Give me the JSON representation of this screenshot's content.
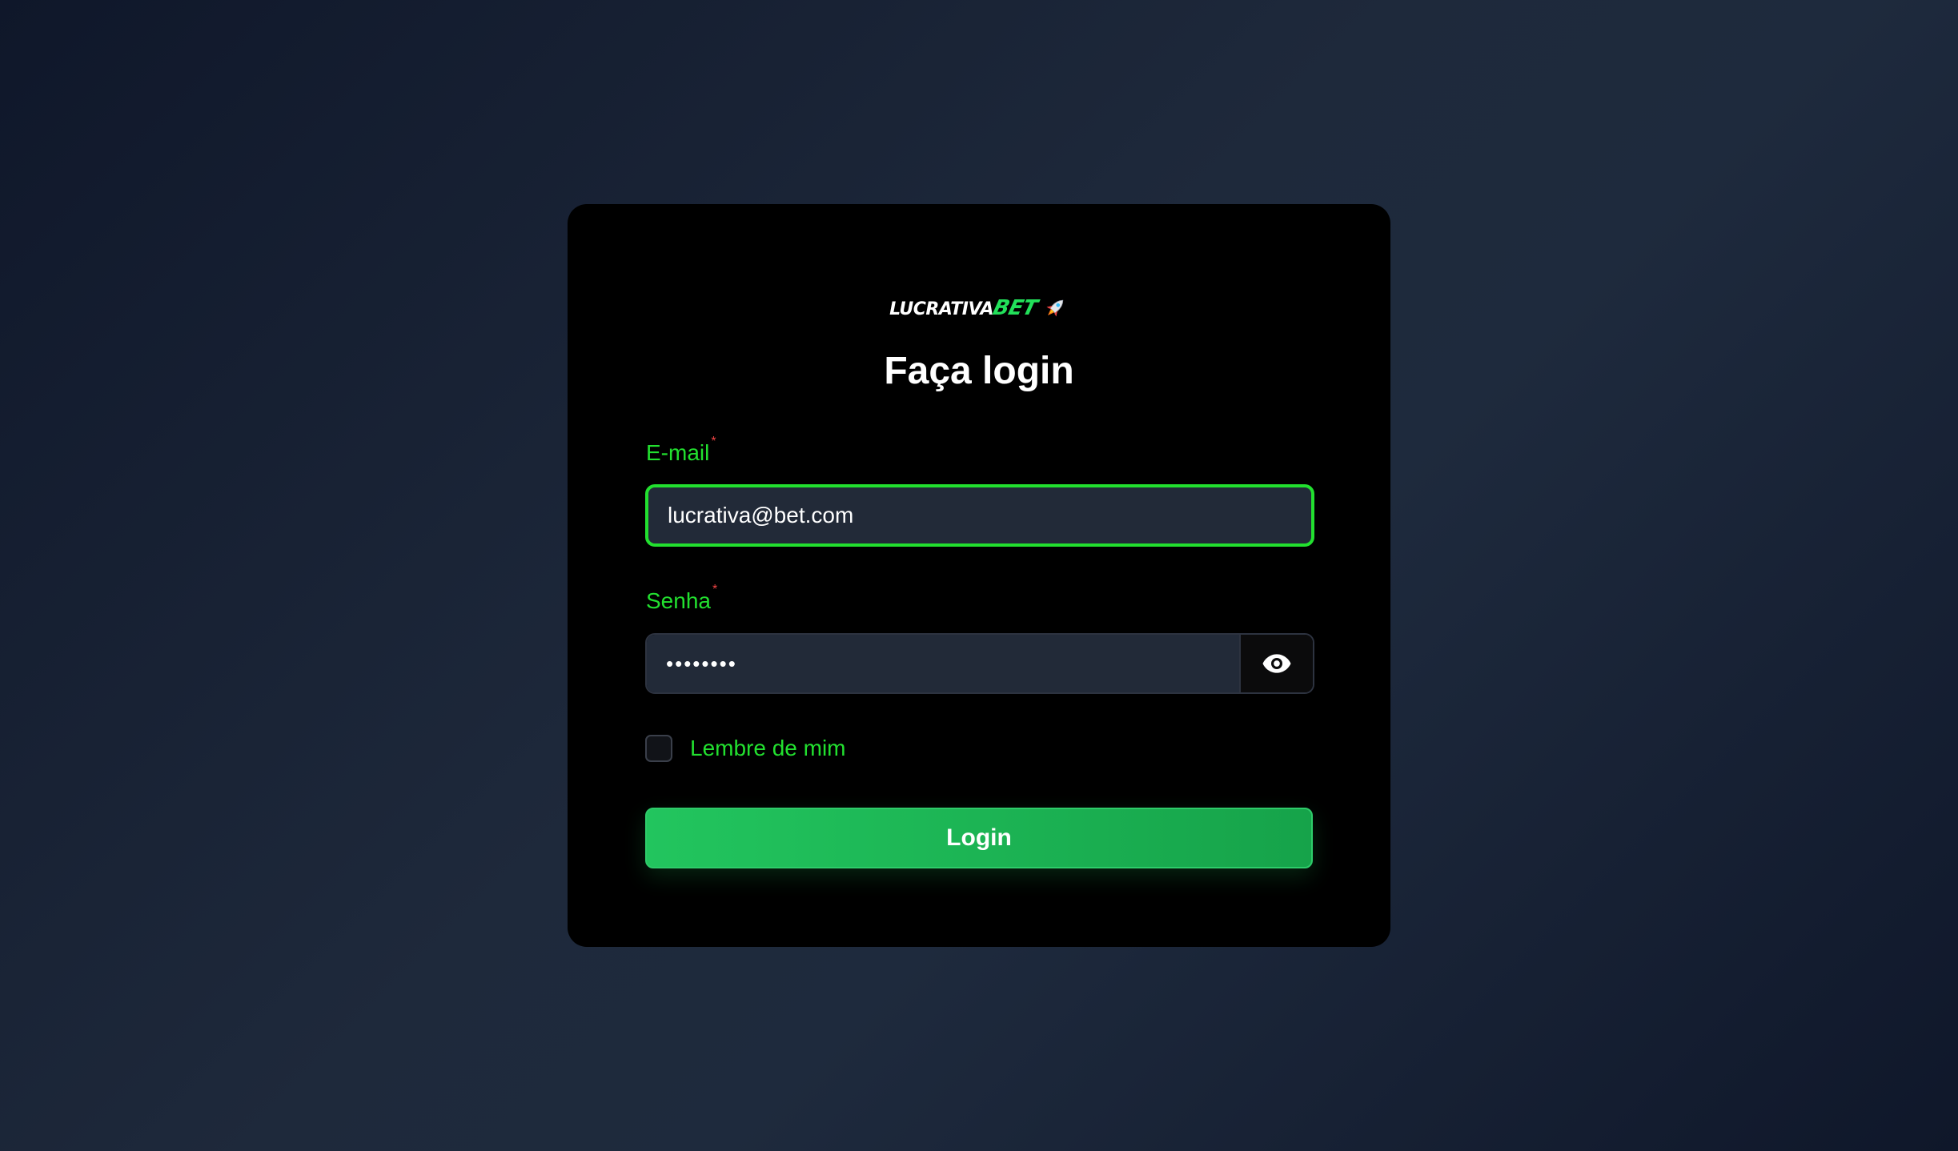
{
  "logo": {
    "text_white": "LUCRATIVA",
    "text_green": "BET",
    "icon": "rocket-icon"
  },
  "form": {
    "title": "Faça login",
    "email": {
      "label": "E-mail",
      "required_mark": "*",
      "value": "lucrativa@bet.com"
    },
    "password": {
      "label": "Senha",
      "required_mark": "*",
      "value": "••••••••",
      "toggle_icon": "eye-icon"
    },
    "remember": {
      "label": "Lembre de mim",
      "checked": false
    },
    "submit_label": "Login"
  },
  "colors": {
    "accent_green": "#22e02f",
    "button_green": "#22c55e",
    "card_bg": "#000000",
    "input_bg": "#222a38",
    "required_red": "#ef4444"
  }
}
